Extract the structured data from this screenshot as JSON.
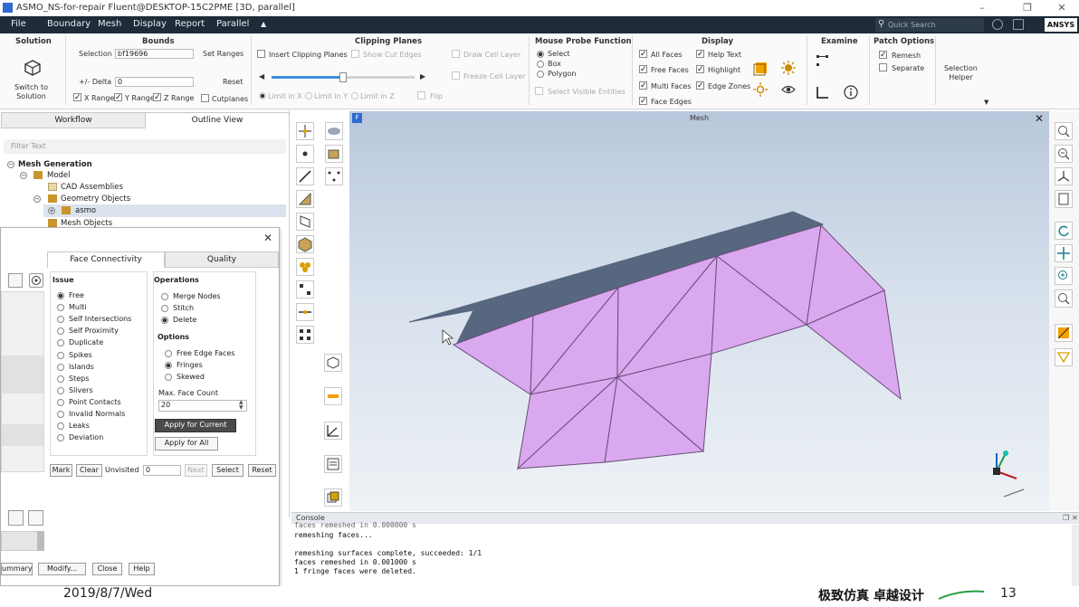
{
  "window": {
    "title": "ASMO_NS-for-repair Fluent@DESKTOP-15C2PME  [3D, parallel]"
  },
  "menu": {
    "items": [
      "File",
      "Boundary",
      "Mesh",
      "Display",
      "Report",
      "Parallel",
      "▲"
    ],
    "search_placeholder": "Quick Search",
    "logo": "ANSYS"
  },
  "ribbon": {
    "solution": {
      "title": "Solution",
      "button_label": "Switch to\nSolution"
    },
    "bounds": {
      "title": "Bounds",
      "selection_label": "Selection",
      "selection_value": "bf19696",
      "set_ranges": "Set Ranges",
      "delta_label": "+/- Delta",
      "delta_value": "0",
      "reset": "Reset",
      "x_range": "X Range",
      "y_range": "Y Range",
      "z_range": "Z Range",
      "cutplanes": "Cutplanes"
    },
    "clipping": {
      "title": "Clipping Planes",
      "insert": "Insert Clipping Planes",
      "show_cut": "Show Cut Edges",
      "draw_cell": "Draw Cell Layer",
      "freeze_cell": "Freeze Cell Layer",
      "limit_x": "Limit in X",
      "limit_y": "Limit in Y",
      "limit_z": "Limit in Z",
      "flip": "Flip",
      "slider_level": 0.5
    },
    "probe": {
      "title": "Mouse Probe Function",
      "select": "Select",
      "box": "Box",
      "polygon": "Polygon",
      "select_visible": "Select Visible Entities"
    },
    "display": {
      "title": "Display",
      "all_faces": "All Faces",
      "free_faces": "Free Faces",
      "multi_faces": "Multi Faces",
      "face_edges": "Face Edges",
      "help_text": "Help Text",
      "highlight": "Highlight",
      "edge_zones": "Edge Zones"
    },
    "examine": {
      "title": "Examine"
    },
    "patch": {
      "title": "Patch Options",
      "remesh": "Remesh",
      "separate": "Separate"
    },
    "selection_helper": "Selection\nHelper"
  },
  "left_panel": {
    "tabs": [
      "Workflow",
      "Outline View"
    ],
    "filter_placeholder": "Filter Text",
    "tree": {
      "root": "Mesh Generation",
      "model": "Model",
      "cad": "CAD Assemblies",
      "geometry": "Geometry Objects",
      "asmo": "asmo",
      "mesh_objects": "Mesh Objects"
    }
  },
  "dialog": {
    "tabs": [
      "Face Connectivity",
      "Quality"
    ],
    "issue_title": "Issue",
    "issues": [
      "Free",
      "Multi",
      "Self Intersections",
      "Self Proximity",
      "Duplicate",
      "Spikes",
      "Islands",
      "Steps",
      "Slivers",
      "Point Contacts",
      "Invalid Normals",
      "Leaks",
      "Deviation"
    ],
    "operations_title": "Operations",
    "operations": [
      "Merge Nodes",
      "Stitch",
      "Delete"
    ],
    "options_title": "Options",
    "options": [
      "Free Edge Faces",
      "Fringes",
      "Skewed"
    ],
    "max_face_count_label": "Max. Face Count",
    "max_face_count_value": "20",
    "apply_current": "Apply for Current",
    "apply_all": "Apply for All",
    "mark": "Mark",
    "clear": "Clear",
    "unvisited_label": "Unvisited",
    "unvisited_value": "0",
    "next": "Next",
    "select": "Select",
    "reset": "Reset",
    "summary": "ummary",
    "modify": "Modify...",
    "close": "Close",
    "help": "Help"
  },
  "graphics": {
    "title": "Mesh",
    "badge": "F"
  },
  "console": {
    "title": "Console",
    "lines": [
      "faces remeshed in 0.000000 s",
      "remeshing faces...",
      "",
      "remeshing surfaces complete, succeeded: 1/1",
      "faces remeshed in 0.001000 s",
      "1 fringe faces were deleted."
    ]
  },
  "footer": {
    "date": "2019/8/7/Wed",
    "slogan": "极致仿真 卓越设计",
    "page": "13"
  },
  "colors": {
    "menubar": "#1f2b38",
    "mesh_face": "#d9a8ee",
    "mesh_edge": "#6b4d7a",
    "mesh_top": "#56677f"
  }
}
